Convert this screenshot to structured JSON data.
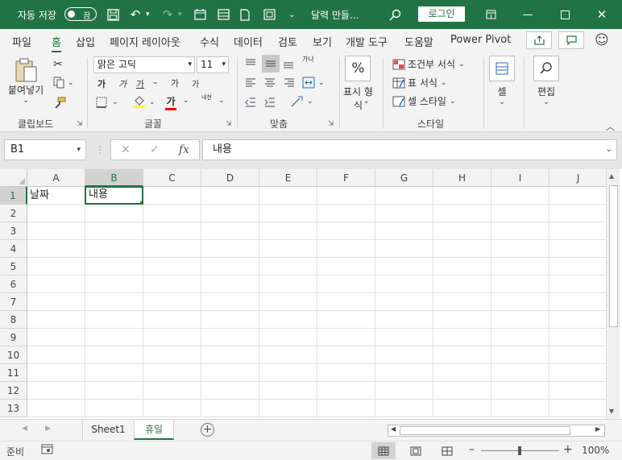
{
  "titlebar": {
    "autosave_label": "자동 저장",
    "autosave_state": "끔",
    "doc_title": "달력 만들...",
    "login_label": "로그인"
  },
  "ribbon_tabs": [
    "파일",
    "홈",
    "삽입",
    "페이지 레이아웃",
    "수식",
    "데이터",
    "검토",
    "보기",
    "개발 도구",
    "도움말",
    "Power Pivot"
  ],
  "ribbon": {
    "clipboard": {
      "paste_label": "붙여넣기",
      "group": "클립보드"
    },
    "font": {
      "font_name": "맑은 고딕",
      "font_size": "11",
      "bold": "가",
      "italic": "가",
      "underline": "가",
      "grow": "가",
      "shrink": "가",
      "font_color": "가",
      "phonetic": "내천",
      "group": "글꼴"
    },
    "align": {
      "wrap": "가나",
      "group": "맞춤"
    },
    "number": {
      "percent": "%",
      "label_line1": "표시 형",
      "label_line2": "식",
      "group": ""
    },
    "styles": {
      "conditional": "조건부 서식",
      "table": "표 서식",
      "cell_style": "셀 스타일",
      "group": "스타일"
    },
    "cells": {
      "label": "셀"
    },
    "editing": {
      "label": "편집"
    }
  },
  "formula_bar": {
    "name_box": "B1",
    "formula_value": "내용",
    "fx_label": "fx"
  },
  "grid": {
    "columns": [
      "A",
      "B",
      "C",
      "D",
      "E",
      "F",
      "G",
      "H",
      "I",
      "J"
    ],
    "rows": [
      "1",
      "2",
      "3",
      "4",
      "5",
      "6",
      "7",
      "8",
      "9",
      "10",
      "11",
      "12",
      "13"
    ],
    "selected_column": "B",
    "selected_row": "1",
    "cells": {
      "A1": "날짜",
      "B1": "내용"
    }
  },
  "sheets": {
    "tabs": [
      "Sheet1",
      "휴일"
    ],
    "active": "휴일"
  },
  "statusbar": {
    "status": "준비",
    "zoom": "100%"
  }
}
